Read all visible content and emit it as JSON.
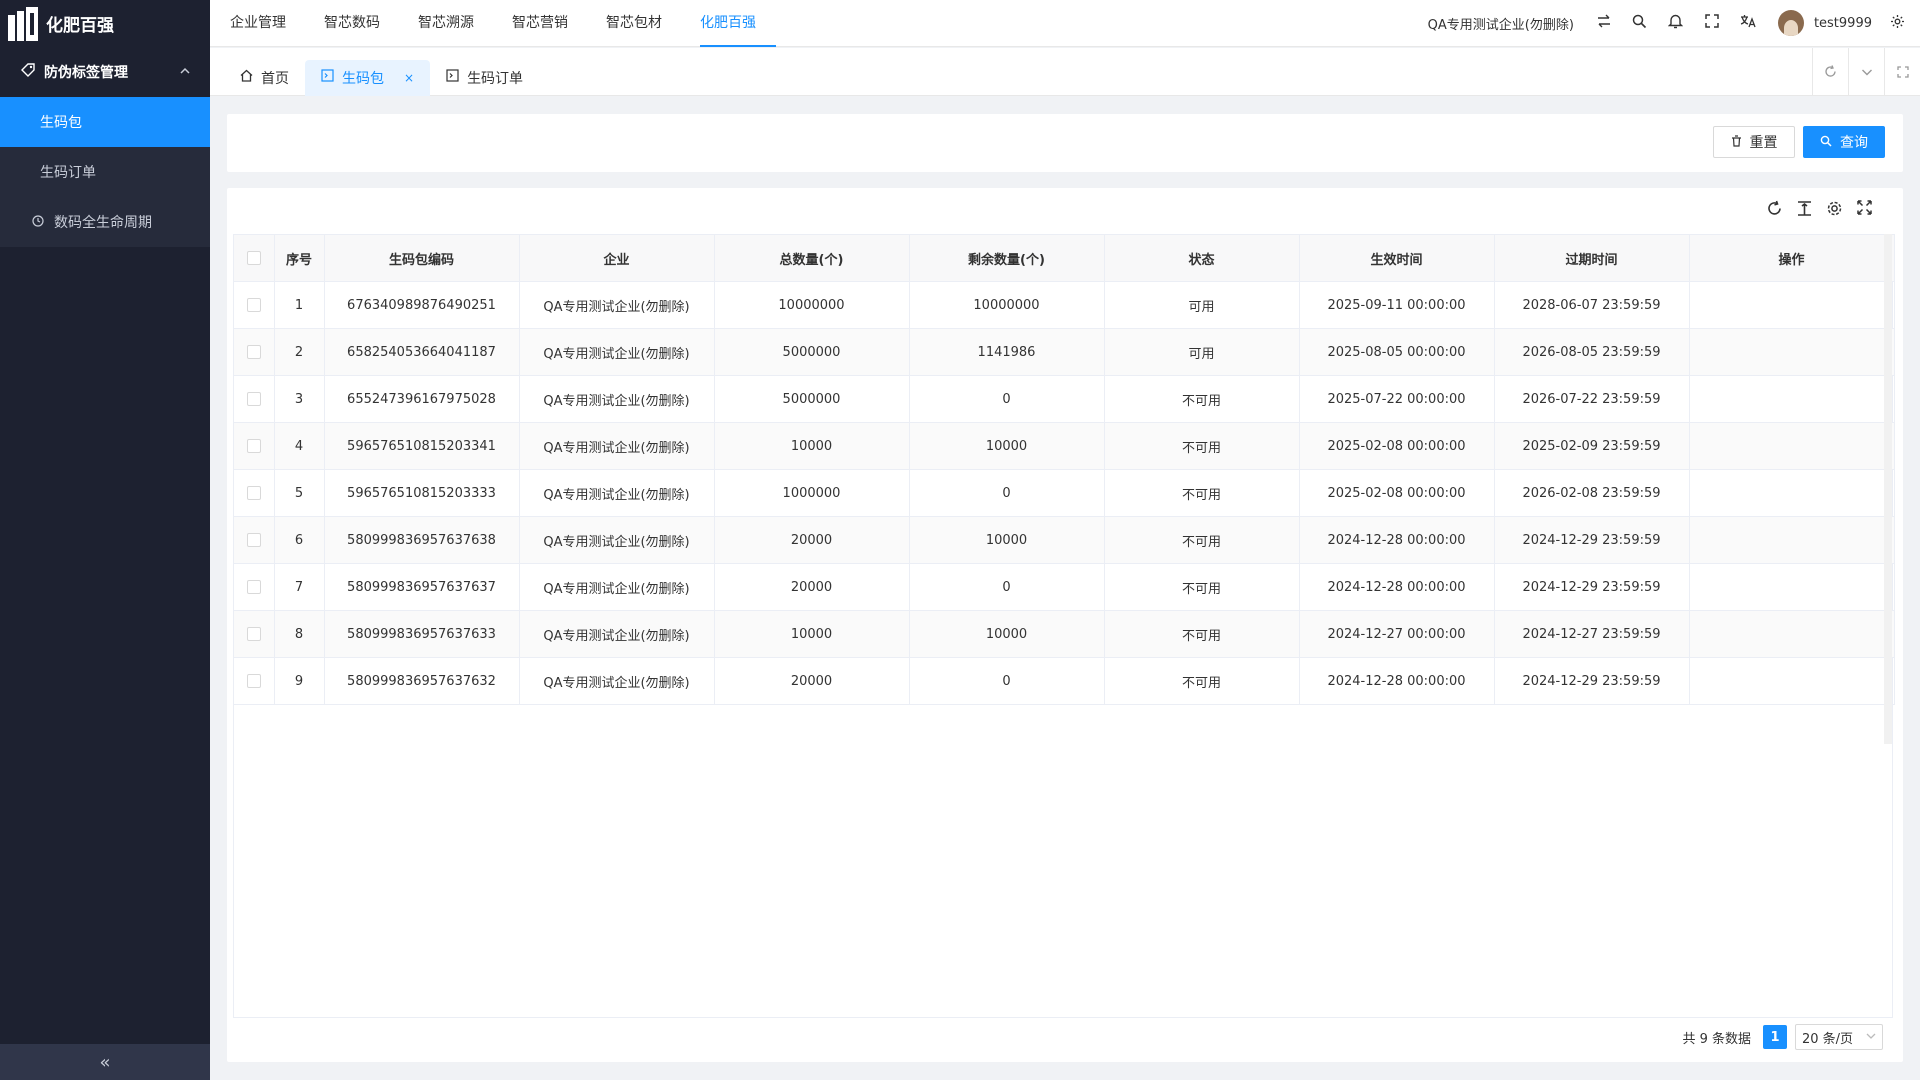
{
  "brand": {
    "name": "化肥百强"
  },
  "sidebar": {
    "group_label": "防伪标签管理",
    "group_icon": "tag-icon",
    "items": [
      {
        "label": "生码包",
        "active": true
      },
      {
        "label": "生码订单",
        "active": false
      },
      {
        "label": "数码全生命周期",
        "active": false,
        "icon": "clock-icon"
      }
    ],
    "collapse_glyph": "«"
  },
  "navbar": {
    "menu": [
      {
        "label": "企业管理",
        "active": false
      },
      {
        "label": "智芯数码",
        "active": false
      },
      {
        "label": "智芯溯源",
        "active": false
      },
      {
        "label": "智芯营销",
        "active": false
      },
      {
        "label": "智芯包材",
        "active": false
      },
      {
        "label": "化肥百强",
        "active": true
      }
    ],
    "org_name": "QA专用测试企业(勿删除)",
    "username": "test9999"
  },
  "tabs": [
    {
      "label": "首页",
      "icon": "home-icon",
      "active": false
    },
    {
      "label": "生码包",
      "icon": "terminal-icon",
      "active": true,
      "closable": true
    },
    {
      "label": "生码订单",
      "icon": "terminal-icon",
      "active": false
    }
  ],
  "search": {
    "reset_label": "重置",
    "query_label": "查询"
  },
  "table": {
    "columns": [
      "序号",
      "生码包编码",
      "企业",
      "总数量(个)",
      "剩余数量(个)",
      "状态",
      "生效时间",
      "过期时间",
      "操作"
    ],
    "rows": [
      [
        "1",
        "676340989876490251",
        "QA专用测试企业(勿删除)",
        "10000000",
        "10000000",
        "可用",
        "2025-09-11 00:00:00",
        "2028-06-07 23:59:59",
        ""
      ],
      [
        "2",
        "658254053664041187",
        "QA专用测试企业(勿删除)",
        "5000000",
        "1141986",
        "可用",
        "2025-08-05 00:00:00",
        "2026-08-05 23:59:59",
        ""
      ],
      [
        "3",
        "655247396167975028",
        "QA专用测试企业(勿删除)",
        "5000000",
        "0",
        "不可用",
        "2025-07-22 00:00:00",
        "2026-07-22 23:59:59",
        ""
      ],
      [
        "4",
        "596576510815203341",
        "QA专用测试企业(勿删除)",
        "10000",
        "10000",
        "不可用",
        "2025-02-08 00:00:00",
        "2025-02-09 23:59:59",
        ""
      ],
      [
        "5",
        "596576510815203333",
        "QA专用测试企业(勿删除)",
        "1000000",
        "0",
        "不可用",
        "2025-02-08 00:00:00",
        "2026-02-08 23:59:59",
        ""
      ],
      [
        "6",
        "580999836957637638",
        "QA专用测试企业(勿删除)",
        "20000",
        "10000",
        "不可用",
        "2024-12-28 00:00:00",
        "2024-12-29 23:59:59",
        ""
      ],
      [
        "7",
        "580999836957637637",
        "QA专用测试企业(勿删除)",
        "20000",
        "0",
        "不可用",
        "2024-12-28 00:00:00",
        "2024-12-29 23:59:59",
        ""
      ],
      [
        "8",
        "580999836957637633",
        "QA专用测试企业(勿删除)",
        "10000",
        "10000",
        "不可用",
        "2024-12-27 00:00:00",
        "2024-12-27 23:59:59",
        ""
      ],
      [
        "9",
        "580999836957637632",
        "QA专用测试企业(勿删除)",
        "20000",
        "0",
        "不可用",
        "2024-12-28 00:00:00",
        "2024-12-29 23:59:59",
        ""
      ]
    ]
  },
  "pagination": {
    "total_text": "共 9 条数据",
    "current_page": "1",
    "page_size": "20 条/页"
  },
  "colors": {
    "primary": "#1890ff",
    "sidebar_bg": "#1d2130"
  }
}
